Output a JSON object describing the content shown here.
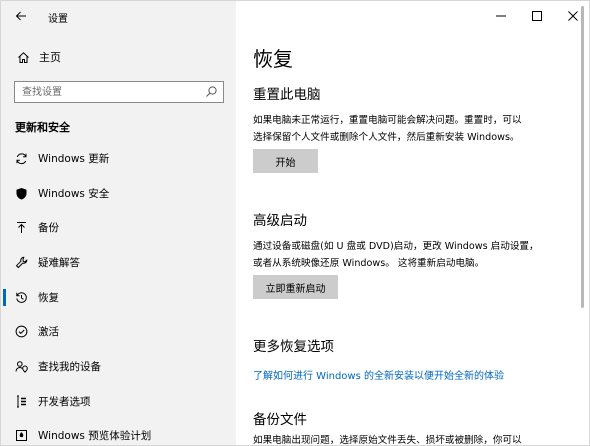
{
  "window": {
    "title": "设置",
    "controls": [
      "minimize-icon",
      "maximize-icon",
      "close-icon"
    ]
  },
  "sidebar": {
    "home_label": "主页",
    "search_placeholder": "查找设置",
    "section_title": "更新和安全",
    "items": [
      {
        "label": "Windows 更新",
        "icon": "sync-icon",
        "active": false
      },
      {
        "label": "Windows 安全",
        "icon": "shield-icon",
        "active": false
      },
      {
        "label": "备份",
        "icon": "backup-arrow-icon",
        "active": false
      },
      {
        "label": "疑难解答",
        "icon": "wrench-icon",
        "active": false
      },
      {
        "label": "恢复",
        "icon": "history-icon",
        "active": true
      },
      {
        "label": "激活",
        "icon": "check-circle-icon",
        "active": false
      },
      {
        "label": "查找我的设备",
        "icon": "person-location-icon",
        "active": false
      },
      {
        "label": "开发者选项",
        "icon": "developer-icon",
        "active": false
      },
      {
        "label": "Windows 预览体验计划",
        "icon": "insider-icon",
        "active": false
      }
    ]
  },
  "main": {
    "title": "恢复",
    "reset": {
      "heading": "重置此电脑",
      "desc_line1": "如果电脑未正常运行，重置电脑可能会解决问题。重置时，可以",
      "desc_line2": "选择保留个人文件或删除个人文件，然后重新安装 Windows。",
      "button": "开始"
    },
    "advanced": {
      "heading": "高级启动",
      "desc_line1": "通过设备或磁盘(如 U 盘或 DVD)启动，更改 Windows 启动设置，",
      "desc_line2": "或者从系统映像还原 Windows。 这将重新启动电脑。",
      "button": "立即重新启动"
    },
    "more": {
      "heading": "更多恢复选项",
      "link": "了解如何进行 Windows 的全新安装以便开始全新的体验"
    },
    "backup": {
      "heading": "备份文件",
      "cut_text": "如果电脑出现问题，选择原始文件丢失、损坏或被删除，你可以"
    }
  },
  "colors": {
    "accent": "#0067c0",
    "sidebar_bg": "#f2f2f2",
    "button_bg": "#cccccc"
  }
}
